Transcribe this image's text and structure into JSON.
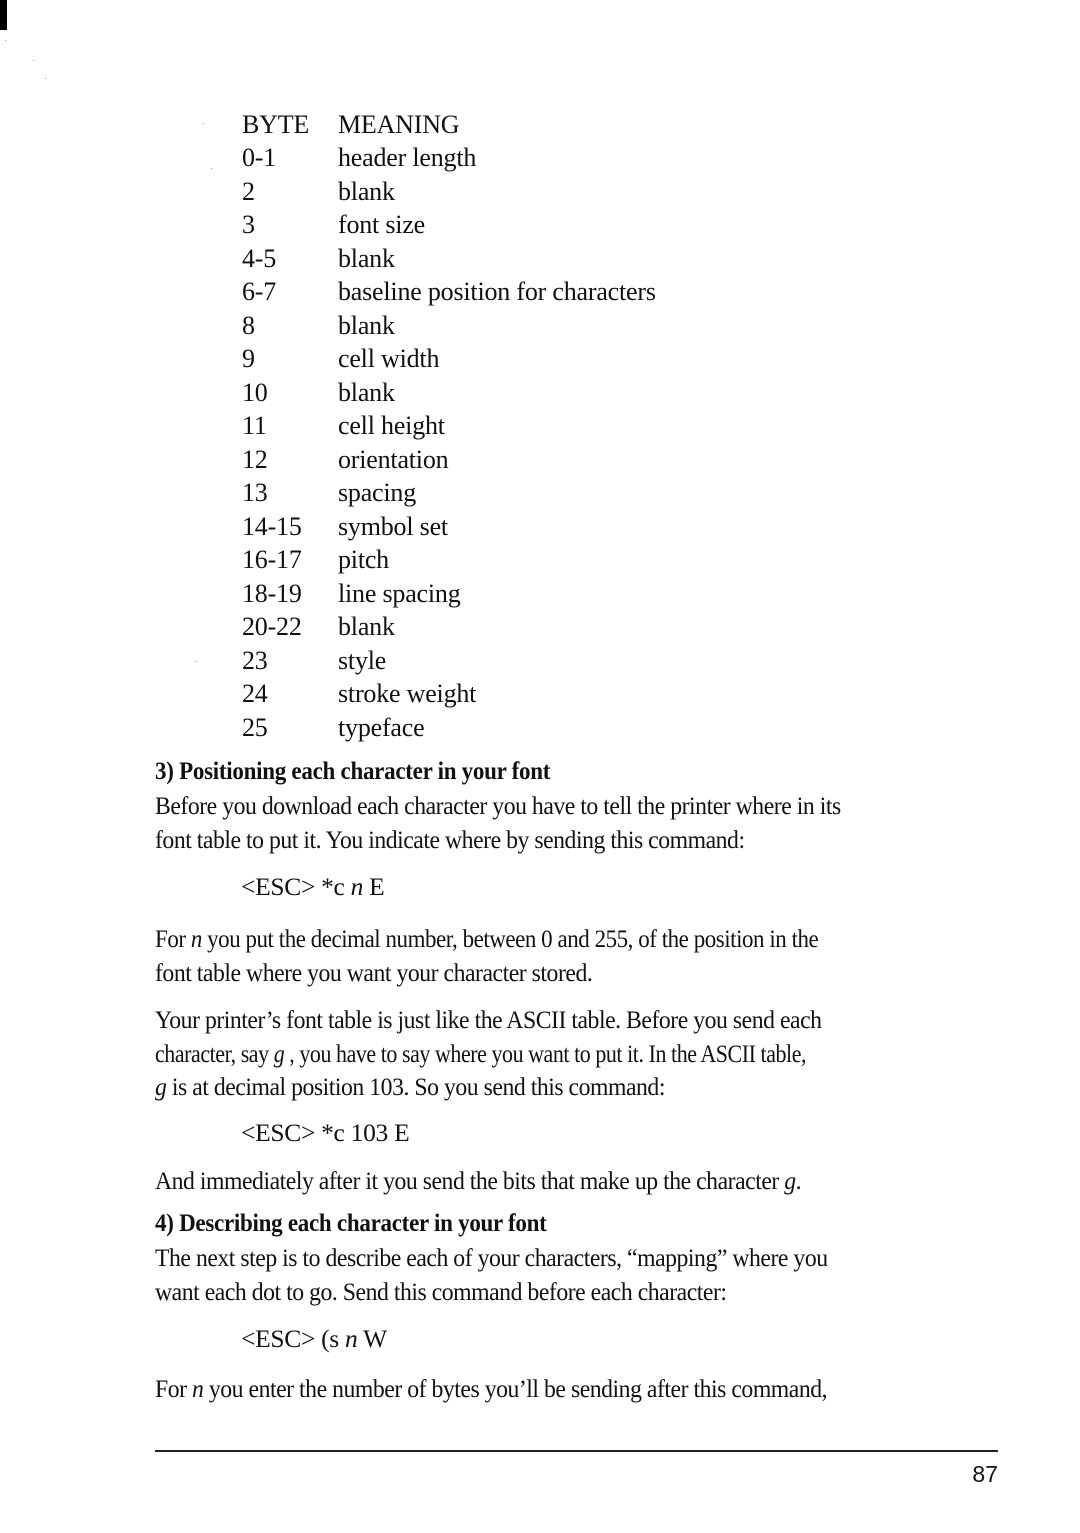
{
  "byte_table": {
    "headers": [
      "BYTE",
      "MEANING"
    ],
    "rows": [
      {
        "byte": "0-1",
        "meaning": "header length"
      },
      {
        "byte": "2",
        "meaning": "blank"
      },
      {
        "byte": "3",
        "meaning": "font size"
      },
      {
        "byte": "4-5",
        "meaning": "blank"
      },
      {
        "byte": "6-7",
        "meaning": "baseline position for characters"
      },
      {
        "byte": "8",
        "meaning": "blank"
      },
      {
        "byte": "9",
        "meaning": "cell width"
      },
      {
        "byte": "10",
        "meaning": "blank"
      },
      {
        "byte": "11",
        "meaning": "cell height"
      },
      {
        "byte": "12",
        "meaning": "orientation"
      },
      {
        "byte": "13",
        "meaning": "spacing"
      },
      {
        "byte": "14-15",
        "meaning": "symbol set"
      },
      {
        "byte": "16-17",
        "meaning": "pitch"
      },
      {
        "byte": "18-19",
        "meaning": "line spacing"
      },
      {
        "byte": "20-22",
        "meaning": "blank"
      },
      {
        "byte": "23",
        "meaning": "style"
      },
      {
        "byte": "24",
        "meaning": "stroke weight"
      },
      {
        "byte": "25",
        "meaning": "typeface"
      }
    ]
  },
  "section3": {
    "heading": "3) Positioning each character in your font",
    "intro_line1": "Before you download each character you have to tell the printer where in its",
    "intro_line2": "font table to put it. You indicate where by sending this command:",
    "command": {
      "prefix": "<ESC> *c ",
      "var": "n",
      "suffix": " E"
    },
    "para2": {
      "a": "For ",
      "var": "n",
      "b": " you put the decimal number, between 0 and 255, of the position in the",
      "line2": "font table where you want your character stored."
    },
    "para3": {
      "line1": "Your printer’s font table is just like the ASCII table. Before you send each",
      "line2a": "character, say ",
      "line2var": "g",
      "line2b": " , you have to say where you want to put it. In the ASCII table,",
      "line3var": "g",
      "line3b": " is at decimal position 103. So you send this command:"
    },
    "command2": "<ESC> *c 103 E",
    "para4": {
      "a": "And immediately after it you send the bits that make up the character ",
      "var": "g",
      "b": "."
    }
  },
  "section4": {
    "heading": "4) Describing each character in your font",
    "line1": "The next step is to describe each of your characters, “mapping” where you",
    "line2": "want each dot to go. Send this command before each character:",
    "command": {
      "prefix": "<ESC> (s ",
      "var": "n",
      "suffix": " W"
    },
    "para": {
      "a": "For ",
      "var": "n",
      "b": " you enter the number of bytes you’ll be sending after this command,"
    }
  },
  "footer": {
    "page_number": "87"
  }
}
